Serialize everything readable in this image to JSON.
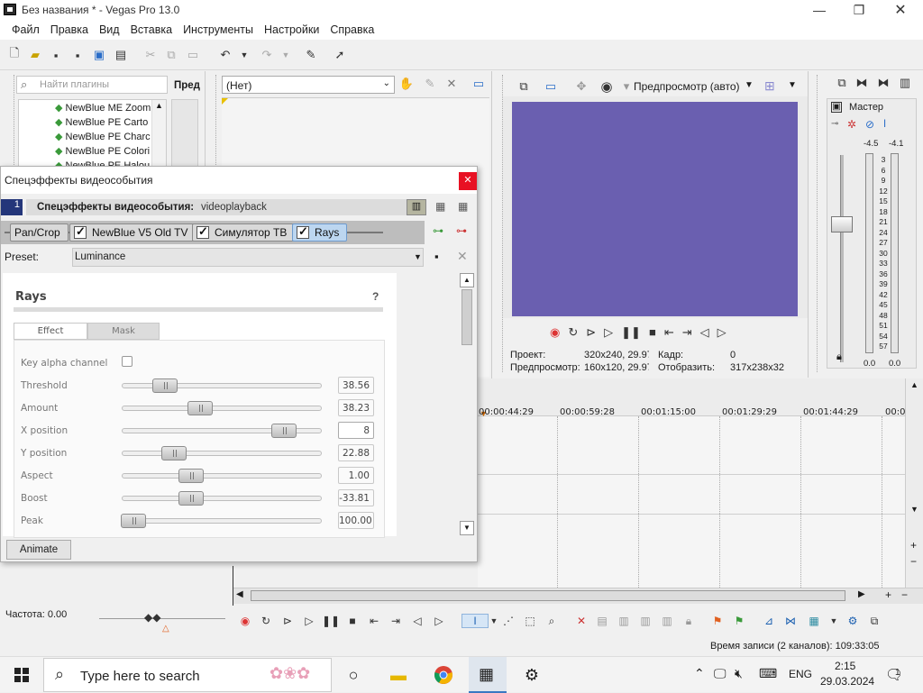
{
  "window": {
    "title": "Без названия * - Vegas Pro 13.0"
  },
  "menu": [
    "Файл",
    "Правка",
    "Вид",
    "Вставка",
    "Инструменты",
    "Настройки",
    "Справка"
  ],
  "explorer": {
    "search_placeholder": "Найти плагины",
    "col2_label": "Пред",
    "plugins": [
      "NewBlue ME Zoom",
      "NewBlue PE Carto",
      "NewBlue PE Charc",
      "NewBlue PE Colori",
      "NewBlue PE Halou"
    ]
  },
  "trimmer": {
    "dropdown_value": "(Нет)"
  },
  "preview": {
    "quality_label": "Предпросмотр (авто)",
    "project_label": "Проект:",
    "project_value": "320x240, 29.97",
    "frame_label": "Кадр:",
    "frame_value": "0",
    "preview_label": "Предпросмотр:",
    "preview_value": "160x120, 29.97",
    "display_label": "Отобразить:",
    "display_value": "317x238x32",
    "surface_color": "#6a5fb0"
  },
  "mixer": {
    "master_label": "Мастер",
    "peak_left": "-4.5",
    "peak_right": "-4.1",
    "scale": [
      "3",
      "6",
      "9",
      "12",
      "15",
      "18",
      "21",
      "24",
      "27",
      "30",
      "33",
      "36",
      "39",
      "42",
      "45",
      "48",
      "51",
      "54",
      "57"
    ],
    "bottom_left": "0.0",
    "bottom_right": "0.0"
  },
  "timeline": {
    "ruler": [
      "00:00:44:29",
      "00:00:59:28",
      "00:01:15:00",
      "00:01:29:29",
      "00:01:44:29",
      "00:0"
    ],
    "rate_label": "Частота: 0.00",
    "status": "Время записи (2 каналов): 109:33:05"
  },
  "dialog": {
    "title": "Спецэффекты видеособытия",
    "track_number": "1",
    "header_label": "Спецэффекты видеособытия:",
    "event_name": "videoplayback",
    "chain": [
      "Pan/Crop",
      "NewBlue V5 Old TV",
      "Симулятор ТВ",
      "Rays"
    ],
    "preset_label": "Preset:",
    "preset_value": "Luminance",
    "animate_label": "Animate",
    "plugin": {
      "name": "Rays",
      "help": "?",
      "tabs": [
        "Effect",
        "Mask"
      ],
      "key_alpha_label": "Key alpha channel",
      "params": [
        {
          "label": "Threshold",
          "value": "38.56",
          "pos": 0.18
        },
        {
          "label": "Amount",
          "value": "38.23",
          "pos": 0.38
        },
        {
          "label": "X position",
          "value": "8",
          "pos": 0.86
        },
        {
          "label": "Y position",
          "value": "22.88",
          "pos": 0.23
        },
        {
          "label": "Aspect",
          "value": "1.00",
          "pos": 0.33
        },
        {
          "label": "Boost",
          "value": "-33.81",
          "pos": 0.33
        },
        {
          "label": "Peak",
          "value": "100.00",
          "pos": 0.0
        }
      ]
    }
  },
  "taskbar": {
    "search_placeholder": "Type here to search",
    "lang": "ENG",
    "time": "2:15",
    "date": "29.03.2024",
    "notifications": "1"
  }
}
